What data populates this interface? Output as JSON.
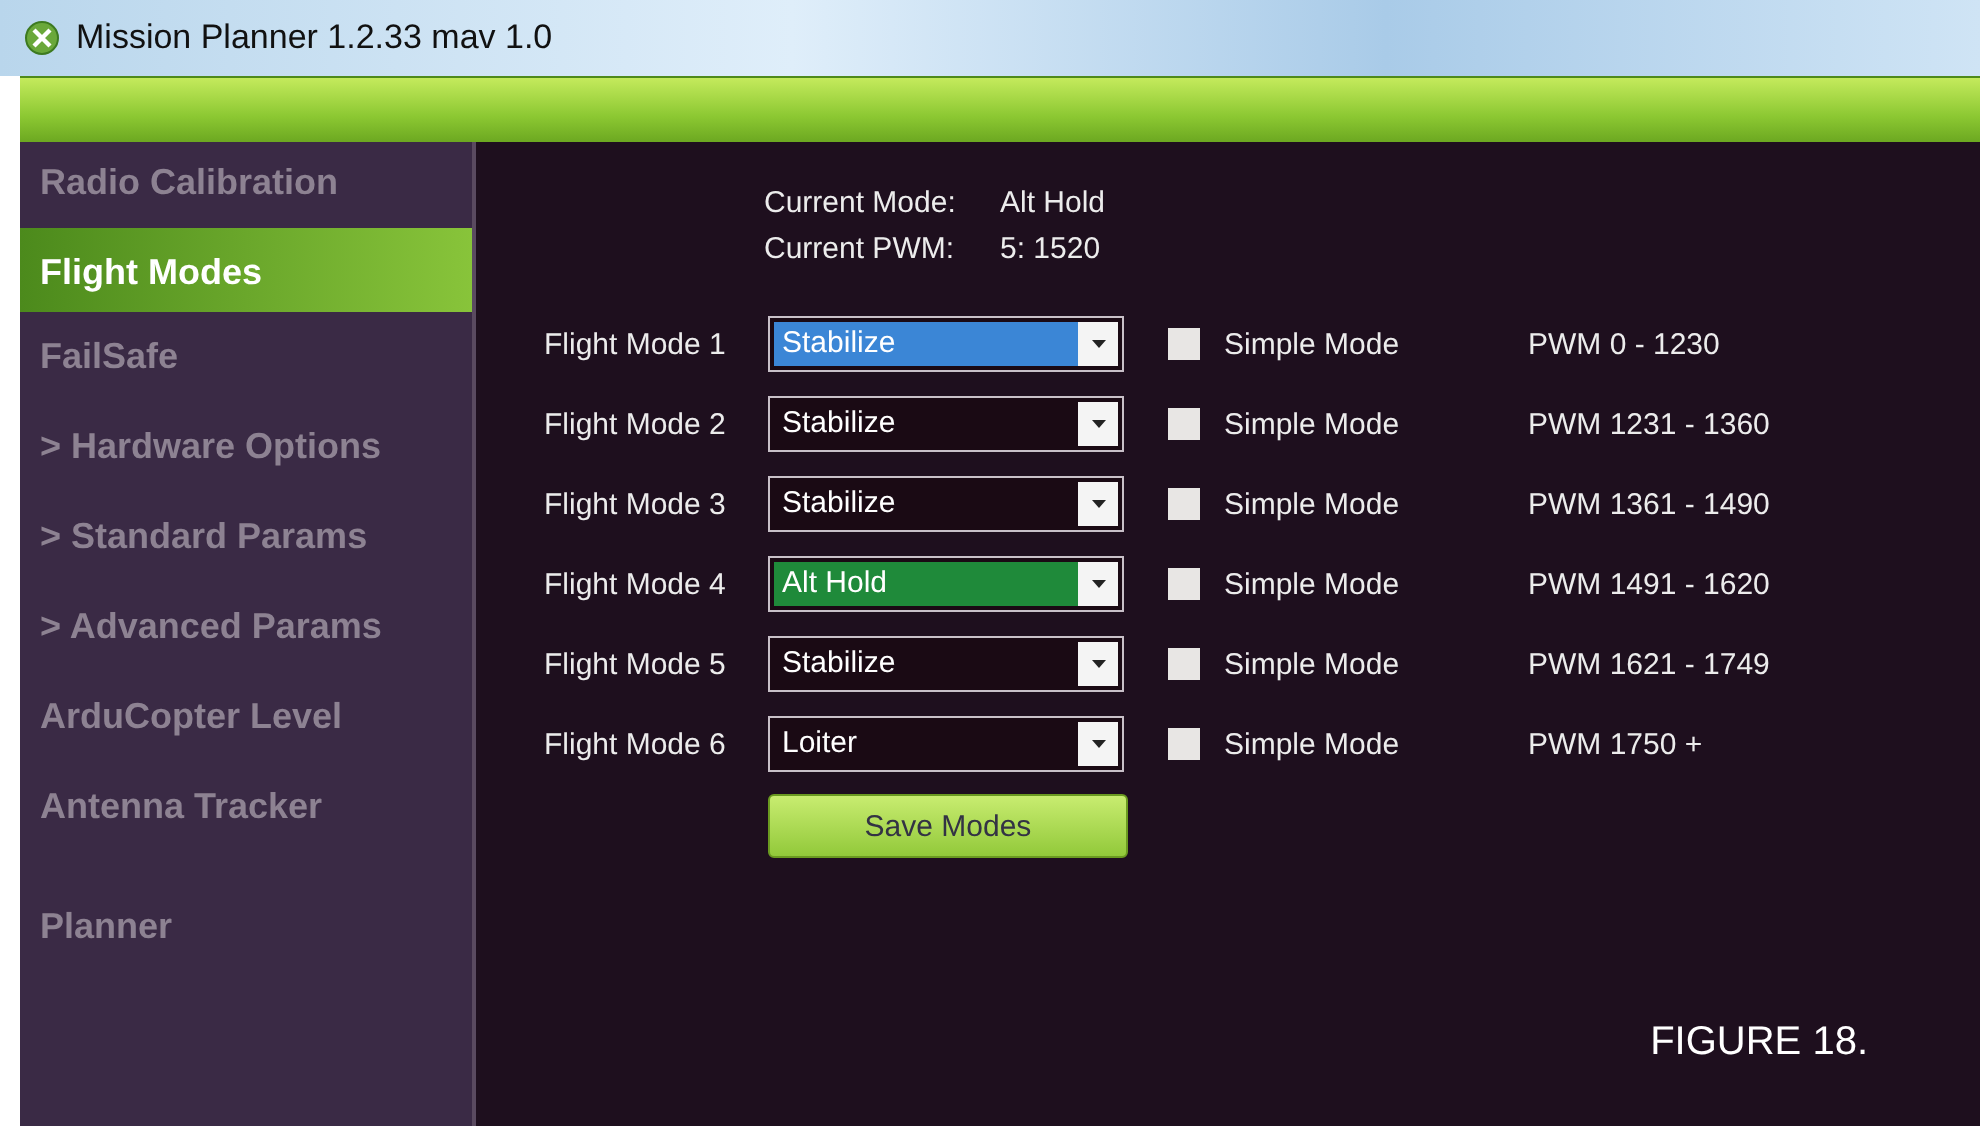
{
  "window": {
    "title": "Mission Planner 1.2.33 mav 1.0"
  },
  "sidebar": {
    "groups": [
      [
        {
          "label": "Radio Calibration",
          "selected": false
        },
        {
          "label": "Flight Modes",
          "selected": true
        },
        {
          "label": "FailSafe",
          "selected": false
        },
        {
          "label": "> Hardware Options",
          "selected": false
        },
        {
          "label": "> Standard Params",
          "selected": false
        },
        {
          "label": "> Advanced Params",
          "selected": false
        },
        {
          "label": "ArduCopter Level",
          "selected": false
        },
        {
          "label": "Antenna Tracker",
          "selected": false
        }
      ],
      [
        {
          "label": "Planner",
          "selected": false
        }
      ]
    ]
  },
  "status": [
    {
      "label": "Current Mode:",
      "value": "Alt Hold"
    },
    {
      "label": "Current PWM:",
      "value": "5: 1520"
    }
  ],
  "modes": [
    {
      "label": "Flight Mode 1",
      "value": "Stabilize",
      "focused": true,
      "current": false,
      "simple_label": "Simple Mode",
      "simple_checked": false,
      "pwm": "PWM 0 - 1230"
    },
    {
      "label": "Flight Mode 2",
      "value": "Stabilize",
      "focused": false,
      "current": false,
      "simple_label": "Simple Mode",
      "simple_checked": false,
      "pwm": "PWM 1231 - 1360"
    },
    {
      "label": "Flight Mode 3",
      "value": "Stabilize",
      "focused": false,
      "current": false,
      "simple_label": "Simple Mode",
      "simple_checked": false,
      "pwm": "PWM 1361 - 1490"
    },
    {
      "label": "Flight Mode 4",
      "value": "Alt Hold",
      "focused": false,
      "current": true,
      "simple_label": "Simple Mode",
      "simple_checked": false,
      "pwm": "PWM 1491 - 1620"
    },
    {
      "label": "Flight Mode 5",
      "value": "Stabilize",
      "focused": false,
      "current": false,
      "simple_label": "Simple Mode",
      "simple_checked": false,
      "pwm": "PWM 1621 - 1749"
    },
    {
      "label": "Flight Mode 6",
      "value": "Loiter",
      "focused": false,
      "current": false,
      "simple_label": "Simple Mode",
      "simple_checked": false,
      "pwm": "PWM 1750 +"
    }
  ],
  "save_button": "Save Modes",
  "caption": "FIGURE 18."
}
